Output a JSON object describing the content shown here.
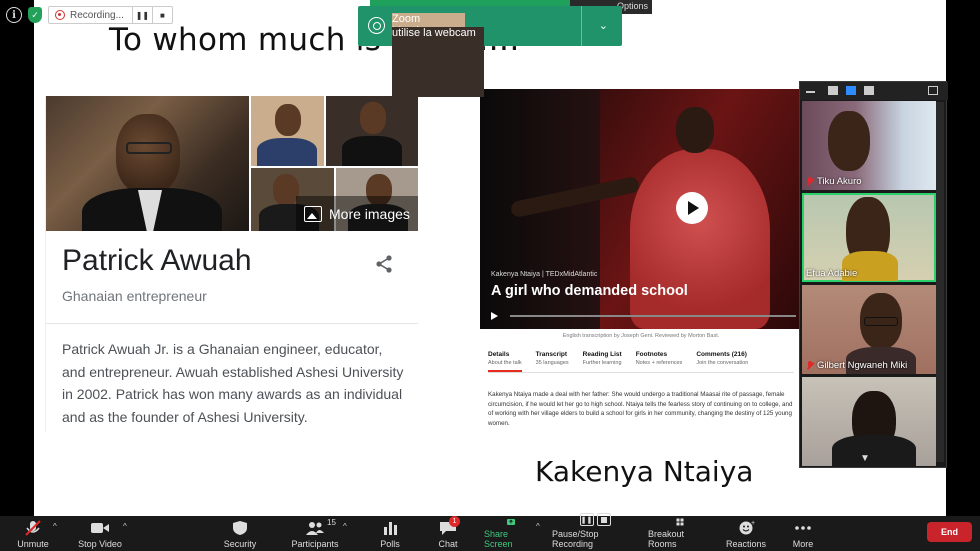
{
  "recording": {
    "label": "Recording...",
    "pause_label": "pause",
    "stop_label": "stop"
  },
  "notification": {
    "behind_options": "Options",
    "line1": "Zoom Meetings",
    "line2": "utilise la webcam"
  },
  "slide": {
    "title": "To whom much is given….",
    "caption": "Kakenya Ntaiya"
  },
  "knowledge_panel": {
    "more_images": "More images",
    "name": "Patrick Awuah",
    "subtitle": "Ghanaian entrepreneur",
    "description": "Patrick Awuah Jr. is a Ghanaian engineer, educator, and entrepreneur. Awuah established Ashesi University in 2002. Patrick has won many awards as an individual and as the founder of Ashesi University."
  },
  "ted": {
    "meta": "Kakenya Ntaiya | TEDxMidAtlantic",
    "title": "A girl who demanded school",
    "credits": "English transcription by Joseph Geni. Reviewed by Morton Bast.",
    "tabs": [
      {
        "title": "Details",
        "sub": "About the talk"
      },
      {
        "title": "Transcript",
        "sub": "35 languages"
      },
      {
        "title": "Reading List",
        "sub": "Further learning"
      },
      {
        "title": "Footnotes",
        "sub": "Notes + references"
      },
      {
        "title": "Comments (216)",
        "sub": "Join the conversation"
      }
    ],
    "paragraph": "Kakenya Ntaiya made a deal with her father: She would undergo a traditional Maasai rite of passage, female circumcision, if he would let her go to high school. Ntaiya tells the fearless story of continuing on to college, and of working with her village elders to build a school for girls in her community, changing the destiny of 125 young women."
  },
  "participants": [
    {
      "name": "Tiku Akuro",
      "muted": true
    },
    {
      "name": "Efua Adabie",
      "muted": false
    },
    {
      "name": "Gilbert Ngwaneh Miki",
      "muted": true
    },
    {
      "name": "",
      "muted": false
    }
  ],
  "toolbar": {
    "unmute": "Unmute",
    "stop_video": "Stop Video",
    "security": "Security",
    "participants": "Participants",
    "participants_count": "15",
    "polls": "Polls",
    "chat": "Chat",
    "chat_badge": "1",
    "share_screen": "Share Screen",
    "pause_recording": "Pause/Stop Recording",
    "breakout_rooms": "Breakout Rooms",
    "reactions": "Reactions",
    "more": "More",
    "end": "End"
  },
  "colors": {
    "share_green": "#3ec97e",
    "end_red": "#c9242b",
    "toast_green": "#21936b",
    "ted_red": "#e62b1e"
  }
}
